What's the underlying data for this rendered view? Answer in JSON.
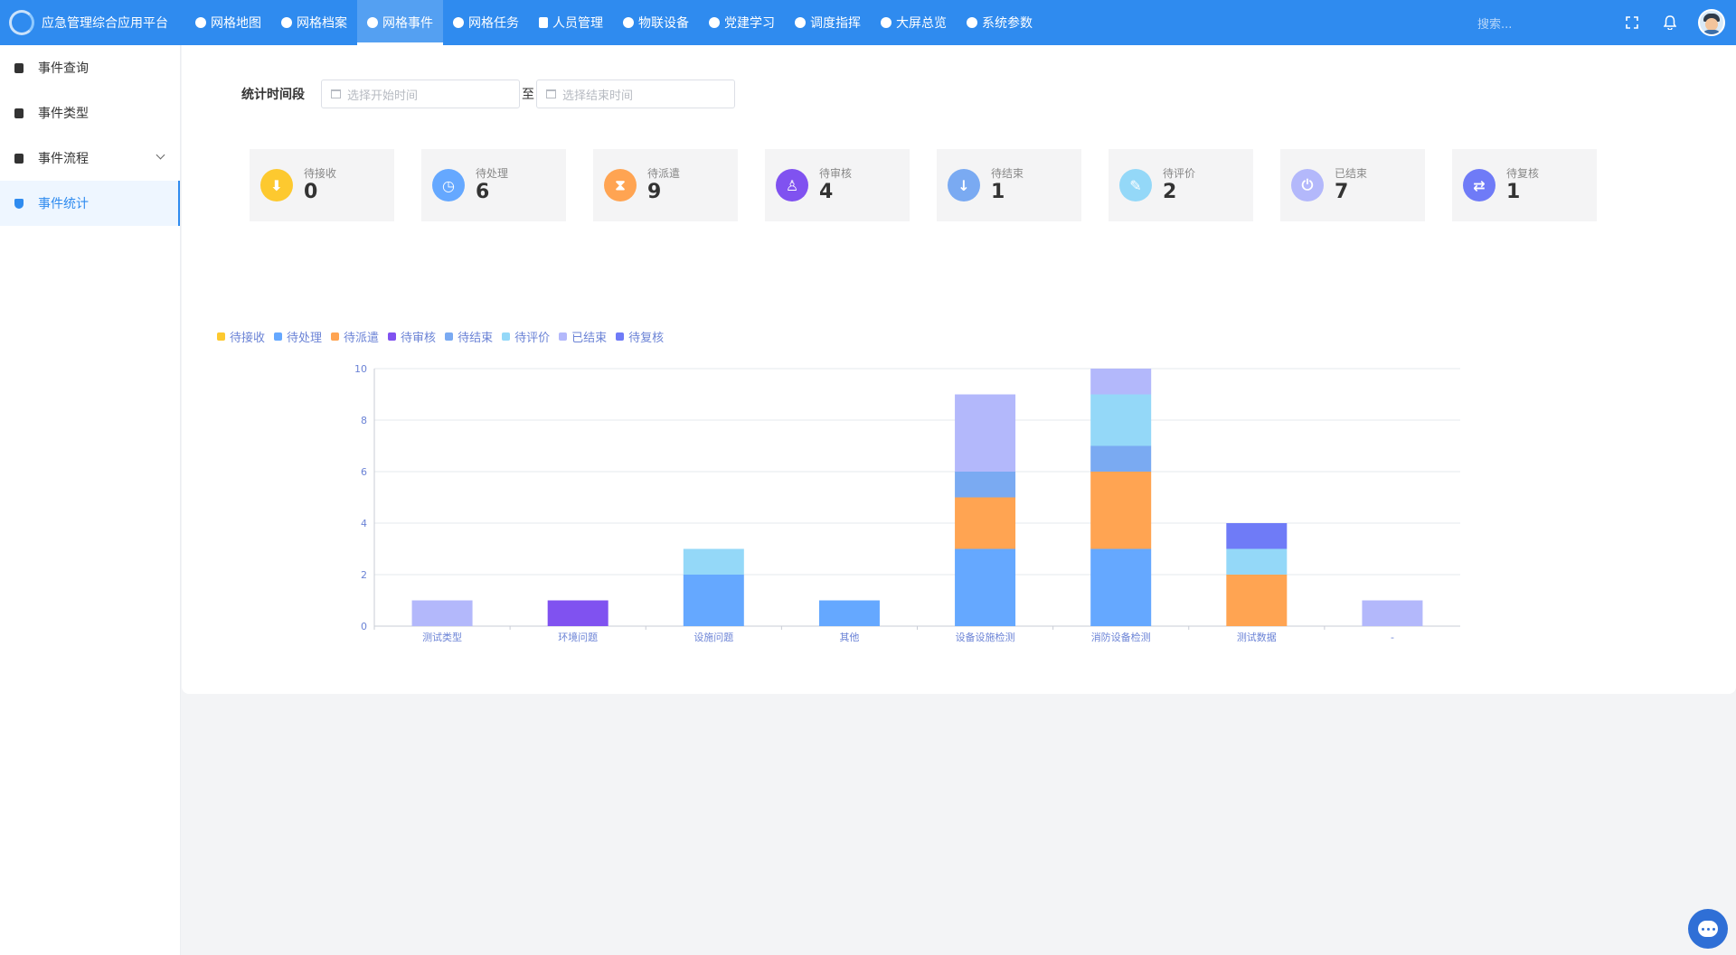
{
  "app": {
    "title": "应急管理综合应用平台"
  },
  "nav": {
    "items": [
      {
        "label": "网格地图",
        "icon": "globe-icon",
        "active": false
      },
      {
        "label": "网格档案",
        "icon": "pie-icon",
        "active": false
      },
      {
        "label": "网格事件",
        "icon": "clock-icon",
        "active": true
      },
      {
        "label": "网格任务",
        "icon": "cloud-icon",
        "active": false
      },
      {
        "label": "人员管理",
        "icon": "document-icon",
        "active": false
      },
      {
        "label": "物联设备",
        "icon": "device-icon",
        "active": false
      },
      {
        "label": "党建学习",
        "icon": "book-icon",
        "active": false
      },
      {
        "label": "调度指挥",
        "icon": "dispatch-icon",
        "active": false
      },
      {
        "label": "大屏总览",
        "icon": "screen-icon",
        "active": false
      },
      {
        "label": "系统参数",
        "icon": "settings-icon",
        "active": false
      }
    ],
    "search_placeholder": "搜索..."
  },
  "sidebar": {
    "items": [
      {
        "label": "事件查询",
        "icon": "trash-icon",
        "active": false,
        "has_children": false
      },
      {
        "label": "事件类型",
        "icon": "cup-icon",
        "active": false,
        "has_children": false
      },
      {
        "label": "事件流程",
        "icon": "layers-icon",
        "active": false,
        "has_children": true
      },
      {
        "label": "事件统计",
        "icon": "shield-icon",
        "active": true,
        "has_children": false
      }
    ]
  },
  "filter": {
    "label": "统计时间段",
    "start_placeholder": "选择开始时间",
    "separator": "至",
    "end_placeholder": "选择结束时间"
  },
  "stat_cards": [
    {
      "label": "待接收",
      "value": "0",
      "color": "#fdc92f",
      "icon": "download-icon",
      "glyph": "⬇"
    },
    {
      "label": "待处理",
      "value": "6",
      "color": "#65a8ff",
      "icon": "clock-icon",
      "glyph": "◷"
    },
    {
      "label": "待派遣",
      "value": "9",
      "color": "#ffa452",
      "icon": "hourglass-icon",
      "glyph": "⧗"
    },
    {
      "label": "待审核",
      "value": "4",
      "color": "#8052f0",
      "icon": "stamp-icon",
      "glyph": "♙"
    },
    {
      "label": "待结束",
      "value": "1",
      "color": "#7aaaf2",
      "icon": "arrow-down-icon",
      "glyph": "↓"
    },
    {
      "label": "待评价",
      "value": "2",
      "color": "#94d8f8",
      "icon": "pencil-icon",
      "glyph": "✎"
    },
    {
      "label": "已结束",
      "value": "7",
      "color": "#b3b8fb",
      "icon": "power-icon",
      "glyph": "⏻"
    },
    {
      "label": "待复核",
      "value": "1",
      "color": "#6f7bf7",
      "icon": "swap-icon",
      "glyph": "⇄"
    }
  ],
  "chart_data": {
    "type": "bar",
    "stacked": true,
    "categories": [
      "测试类型",
      "环境问题",
      "设施问题",
      "其他",
      "设备设施检测",
      "消防设备检测",
      "测试数据",
      "-"
    ],
    "series": [
      {
        "name": "待接收",
        "color": "#fdc92f",
        "values": [
          0,
          0,
          0,
          0,
          0,
          0,
          0,
          0
        ]
      },
      {
        "name": "待处理",
        "color": "#65a8ff",
        "values": [
          0,
          0,
          2,
          1,
          3,
          3,
          0,
          0
        ]
      },
      {
        "name": "待派遣",
        "color": "#ffa452",
        "values": [
          0,
          0,
          0,
          0,
          2,
          3,
          2,
          0
        ]
      },
      {
        "name": "待审核",
        "color": "#8052f0",
        "values": [
          0,
          1,
          0,
          0,
          0,
          0,
          0,
          0
        ]
      },
      {
        "name": "待结束",
        "color": "#7aaaf2",
        "values": [
          0,
          0,
          0,
          0,
          1,
          1,
          0,
          0
        ]
      },
      {
        "name": "待评价",
        "color": "#94d8f8",
        "values": [
          0,
          0,
          1,
          0,
          0,
          2,
          1,
          0
        ]
      },
      {
        "name": "已结束",
        "color": "#b3b8fb",
        "values": [
          1,
          0,
          0,
          0,
          3,
          1,
          0,
          1
        ]
      },
      {
        "name": "待复核",
        "color": "#6f7bf7",
        "values": [
          0,
          0,
          0,
          0,
          0,
          0,
          1,
          0
        ]
      }
    ],
    "ylim": [
      0,
      10
    ],
    "yticks": [
      0,
      2,
      4,
      6,
      8,
      10
    ],
    "grid": true,
    "legend_position": "top-left",
    "axis_label_color": "#6b83d6"
  }
}
